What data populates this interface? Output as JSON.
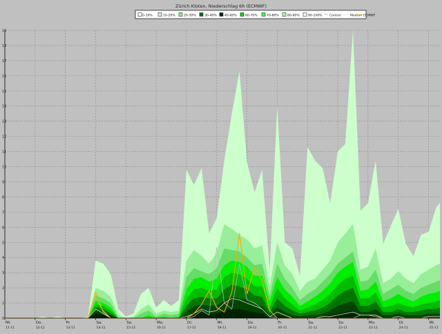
{
  "chart_data": {
    "type": "area",
    "title": "Zürich Kloten, Niederschlag 6h (ECMWF)",
    "xlabel": "",
    "ylabel": "",
    "ylim": [
      0,
      19
    ],
    "yticks": [
      0,
      1,
      2,
      3,
      4,
      5,
      6,
      7,
      8,
      9,
      10,
      11,
      12,
      13,
      14,
      15,
      16,
      17,
      18,
      19
    ],
    "grid": true,
    "legend_position": "top-center",
    "legend": [
      {
        "label": "0-10%",
        "color": "#ffffff",
        "kind": "box"
      },
      {
        "label": "10-20%",
        "color": "#ccffcc",
        "kind": "box"
      },
      {
        "label": "20-30%",
        "color": "#99ee99",
        "kind": "box"
      },
      {
        "label": "30-40%",
        "color": "#007700",
        "kind": "box"
      },
      {
        "label": "40-60%",
        "color": "#002800",
        "kind": "box"
      },
      {
        "label": "60-70%",
        "color": "#00dd00",
        "kind": "box"
      },
      {
        "label": "70-80%",
        "color": "#44ff44",
        "kind": "box"
      },
      {
        "label": "80-90%",
        "color": "#aaffaa",
        "kind": "box"
      },
      {
        "label": "90-100%",
        "color": "#ffffff",
        "kind": "box"
      },
      {
        "label": "Control",
        "color": "#bbbbbb",
        "kind": "line"
      },
      {
        "label": "Median",
        "color": "#dddddd",
        "kind": "line"
      },
      {
        "label": "ECMWF",
        "color": "#ffaa00",
        "kind": "line"
      }
    ],
    "x_ticks": [
      {
        "day": "Mi.",
        "date": "11-11",
        "t": 0
      },
      {
        "day": "Do.",
        "date": "12-11",
        "t": 4
      },
      {
        "day": "Fr.",
        "date": "13-11",
        "t": 8
      },
      {
        "day": "Sa.",
        "date": "14-11",
        "t": 12
      },
      {
        "day": "So.",
        "date": "15-11",
        "t": 16
      },
      {
        "day": "Mo.",
        "date": "16-11",
        "t": 20
      },
      {
        "day": "Di.",
        "date": "17-11",
        "t": 24
      },
      {
        "day": "Mi.",
        "date": "18-11",
        "t": 28
      },
      {
        "day": "Do.",
        "date": "19-11",
        "t": 32
      },
      {
        "day": "Fr.",
        "date": "20-11",
        "t": 36
      },
      {
        "day": "Sa.",
        "date": "21-11",
        "t": 40
      },
      {
        "day": "So.",
        "date": "22-11",
        "t": 44
      },
      {
        "day": "Mo.",
        "date": "23-11",
        "t": 48
      },
      {
        "day": "Di.",
        "date": "24-11",
        "t": 52
      },
      {
        "day": "Mi.",
        "date": "25-11",
        "t": 56
      }
    ],
    "t_max": 57.5,
    "t": [
      0,
      1,
      2,
      3,
      4,
      5,
      6,
      7,
      8,
      9,
      10,
      11,
      12,
      13,
      14,
      15,
      16,
      17,
      18,
      19,
      20,
      21,
      22,
      23,
      24,
      25,
      26,
      27,
      28,
      29,
      30,
      31,
      32,
      33,
      34,
      35,
      36,
      37,
      38,
      39,
      40,
      41,
      42,
      43,
      44,
      45,
      46,
      47,
      48,
      49,
      50,
      51,
      52,
      53,
      54,
      55,
      56,
      57,
      57.5
    ],
    "bands": [
      {
        "name": "90-100%",
        "color": "#ccffcc",
        "values": [
          0,
          0,
          0,
          0,
          0,
          0.1,
          0,
          0.1,
          0,
          0,
          0,
          0.1,
          3.8,
          3.6,
          2.9,
          0.6,
          0.1,
          0.3,
          1.6,
          2.0,
          0.7,
          1.2,
          0.8,
          1.2,
          9.8,
          8.8,
          9.9,
          5.6,
          6.6,
          10.4,
          13.5,
          16.3,
          10.3,
          8.3,
          9.8,
          3.1,
          14.0,
          5.0,
          4.6,
          2.8,
          11.3,
          10.4,
          9.9,
          7.6,
          11.0,
          11.5,
          19.0,
          7.1,
          7.6,
          10.4,
          4.9,
          6.1,
          7.2,
          4.9,
          4.1,
          5.5,
          5.7,
          7.3,
          7.6
        ]
      },
      {
        "name": "80-90%",
        "color": "#99ee99",
        "values": [
          0,
          0,
          0,
          0,
          0,
          0,
          0,
          0,
          0,
          0,
          0,
          0,
          2.0,
          1.8,
          1.4,
          0.2,
          0,
          0.1,
          0.6,
          0.9,
          0.3,
          0.5,
          0.4,
          0.5,
          3.8,
          4.5,
          4.1,
          3.6,
          4.3,
          6.2,
          5.9,
          5.5,
          5.2,
          4.6,
          4.8,
          2.1,
          5.0,
          3.5,
          2.9,
          1.8,
          2.4,
          2.6,
          3.2,
          3.8,
          5.0,
          5.6,
          6.2,
          3.2,
          3.4,
          4.6,
          2.3,
          2.6,
          3.1,
          2.6,
          2.3,
          2.9,
          3.2,
          3.5,
          3.6
        ]
      },
      {
        "name": "70-80%",
        "color": "#66dd66",
        "values": [
          0,
          0,
          0,
          0,
          0,
          0,
          0,
          0,
          0,
          0,
          0,
          0,
          1.5,
          1.3,
          1.0,
          0,
          0,
          0,
          0.3,
          0.5,
          0.1,
          0.3,
          0.2,
          0.3,
          2.7,
          3.3,
          3.1,
          2.9,
          3.3,
          4.6,
          4.5,
          4.4,
          4.0,
          3.5,
          3.6,
          1.5,
          3.6,
          2.6,
          2.0,
          1.2,
          1.6,
          1.9,
          2.4,
          2.9,
          3.6,
          4.0,
          4.4,
          2.4,
          2.5,
          3.2,
          1.6,
          1.9,
          2.2,
          1.8,
          1.6,
          2.0,
          2.2,
          2.4,
          2.5
        ]
      },
      {
        "name": "60-70%",
        "color": "#00ee00",
        "values": [
          0,
          0,
          0,
          0,
          0,
          0,
          0,
          0,
          0,
          0,
          0,
          0,
          1.2,
          1.0,
          0.7,
          0,
          0,
          0,
          0,
          0.2,
          0,
          0.1,
          0,
          0.1,
          1.9,
          2.6,
          2.7,
          2.4,
          2.6,
          3.5,
          3.8,
          3.7,
          3.4,
          2.8,
          2.8,
          1.1,
          2.7,
          1.9,
          1.4,
          0.8,
          1.1,
          1.4,
          1.8,
          2.3,
          3.0,
          3.4,
          3.7,
          1.8,
          1.9,
          2.4,
          1.1,
          1.3,
          1.6,
          1.3,
          1.1,
          1.4,
          1.6,
          1.7,
          1.8
        ]
      },
      {
        "name": "40-60%",
        "color": "#00bb00",
        "values": [
          0,
          0,
          0,
          0,
          0,
          0,
          0,
          0,
          0,
          0,
          0,
          0,
          0.9,
          0.8,
          0.5,
          0,
          0,
          0,
          0,
          0,
          0,
          0,
          0,
          0,
          1.3,
          1.9,
          2.0,
          1.8,
          1.9,
          2.7,
          3.0,
          2.9,
          2.6,
          2.1,
          2.1,
          0.7,
          2.0,
          1.3,
          0.9,
          0.5,
          0.7,
          0.9,
          1.2,
          1.6,
          2.2,
          2.6,
          2.8,
          1.3,
          1.3,
          1.7,
          0.7,
          0.8,
          1.0,
          0.8,
          0.7,
          0.9,
          1.0,
          1.1,
          1.2
        ]
      },
      {
        "name": "30-40%",
        "color": "#007700",
        "values": [
          0,
          0,
          0,
          0,
          0,
          0,
          0,
          0,
          0,
          0,
          0,
          0,
          0.7,
          0.6,
          0.3,
          0,
          0,
          0,
          0,
          0,
          0,
          0,
          0,
          0,
          0.8,
          1.3,
          1.4,
          1.3,
          1.3,
          1.9,
          2.2,
          2.1,
          1.9,
          1.5,
          1.4,
          0.4,
          1.3,
          0.8,
          0.5,
          0.3,
          0.4,
          0.5,
          0.7,
          1.0,
          1.5,
          1.8,
          2.0,
          0.8,
          0.8,
          1.1,
          0.4,
          0.4,
          0.6,
          0.4,
          0.4,
          0.5,
          0.6,
          0.6,
          0.7
        ]
      },
      {
        "name": "20-30%",
        "color": "#004400",
        "values": [
          0,
          0,
          0,
          0,
          0,
          0,
          0,
          0,
          0,
          0,
          0,
          0,
          0.5,
          0.4,
          0.2,
          0,
          0,
          0,
          0,
          0,
          0,
          0,
          0,
          0,
          0.4,
          0.8,
          0.9,
          0.8,
          0.8,
          1.2,
          1.4,
          1.3,
          1.2,
          0.9,
          0.8,
          0.2,
          0.7,
          0.4,
          0.2,
          0.1,
          0.2,
          0.2,
          0.3,
          0.5,
          0.8,
          1.0,
          1.1,
          0.4,
          0.4,
          0.6,
          0.2,
          0.2,
          0.3,
          0.2,
          0.2,
          0.2,
          0.3,
          0.3,
          0.3
        ]
      },
      {
        "name": "10-20%",
        "color": "#002200",
        "values": [
          0,
          0,
          0,
          0,
          0,
          0,
          0,
          0,
          0,
          0,
          0,
          0,
          0.3,
          0.2,
          0.1,
          0,
          0,
          0,
          0,
          0,
          0,
          0,
          0,
          0,
          0.1,
          0.3,
          0.4,
          0.3,
          0.3,
          0.5,
          0.6,
          0.6,
          0.5,
          0.4,
          0.3,
          0,
          0.2,
          0.1,
          0,
          0,
          0,
          0,
          0.1,
          0.2,
          0.3,
          0.4,
          0.5,
          0.1,
          0.1,
          0.2,
          0,
          0,
          0.1,
          0,
          0,
          0,
          0.1,
          0.1,
          0.1
        ]
      }
    ],
    "series": [
      {
        "name": "ECMWF",
        "color": "#ffaa00",
        "values": [
          0,
          0,
          0,
          0,
          0,
          0,
          0,
          0,
          0,
          0,
          0,
          0,
          1.7,
          0.4,
          0,
          0,
          0,
          0,
          0,
          0,
          0,
          0,
          0,
          0,
          0,
          0.3,
          0.9,
          1.8,
          0.7,
          0.4,
          1.7,
          5.6,
          1.6,
          3.3,
          2.5,
          0.5,
          0,
          0,
          0,
          0,
          0,
          0,
          0,
          0,
          0,
          0,
          0,
          0,
          0,
          0,
          0,
          0,
          0,
          0,
          0,
          0,
          0,
          0,
          0
        ]
      },
      {
        "name": "Control",
        "color": "#bbbbbb",
        "values": [
          0,
          0,
          0,
          0,
          0,
          0,
          0,
          0,
          0,
          0,
          0,
          0,
          1.3,
          0.5,
          0,
          0,
          0,
          0,
          0,
          0,
          0,
          0,
          0,
          0,
          0,
          0.1,
          0.5,
          0.2,
          4.7,
          1.0,
          0.6,
          3.6,
          1.2,
          1.0,
          0.6,
          0.1,
          0,
          0,
          0,
          0,
          0,
          0,
          0,
          0,
          0,
          0,
          0,
          0.2,
          0.2,
          0.1,
          0,
          0,
          0,
          0,
          0,
          0,
          0,
          0,
          0
        ]
      },
      {
        "name": "Median",
        "color": "#dddddd",
        "values": [
          0,
          0,
          0,
          0,
          0,
          0,
          0,
          0,
          0,
          0,
          0,
          0,
          0.6,
          0.3,
          0,
          0,
          0,
          0,
          0,
          0,
          0,
          0,
          0,
          0,
          0.1,
          0.3,
          0.6,
          0.4,
          0.5,
          1.0,
          1.3,
          1.2,
          1.0,
          0.8,
          0.6,
          0.1,
          0.4,
          0.2,
          0,
          0,
          0,
          0,
          0.1,
          0.1,
          0.2,
          0.3,
          0.4,
          0.2,
          0.2,
          0.2,
          0,
          0,
          0.1,
          0,
          0,
          0,
          0.1,
          0.1,
          0.1
        ]
      }
    ]
  }
}
